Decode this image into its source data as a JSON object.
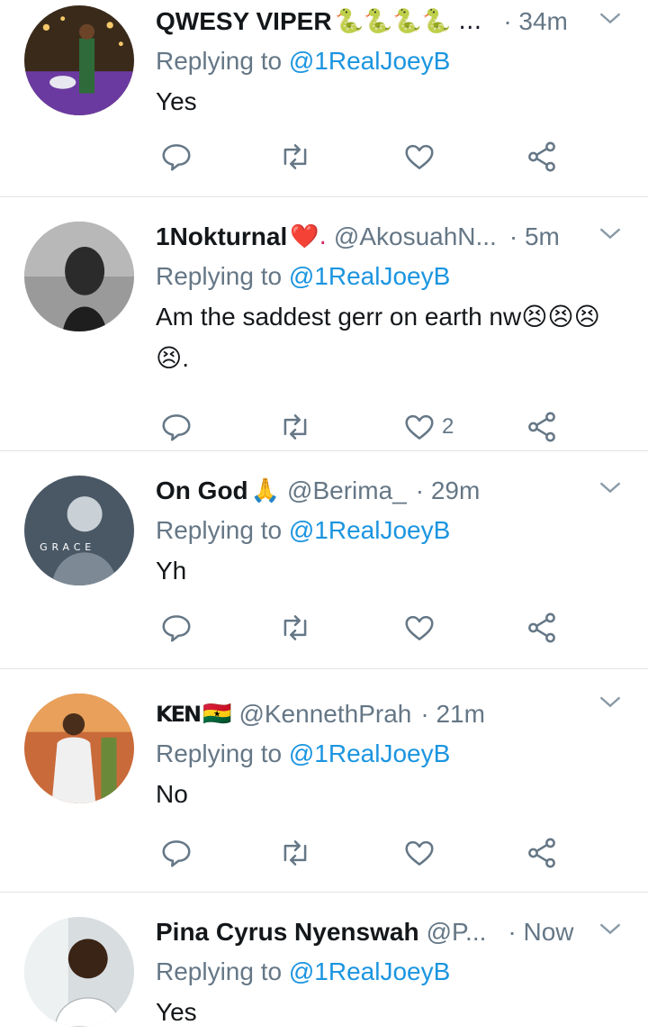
{
  "colors": {
    "link": "#1b95e0",
    "meta": "#657786",
    "text": "#14171a",
    "divider": "#dfe3e7"
  },
  "tweets": [
    {
      "name": "QWESY VIPER",
      "emoji": "🐍🐍🐍🐍 …",
      "handle": "",
      "time": "· 34m",
      "replying_prefix": "Replying to ",
      "replying_to": "@1RealJoeyB",
      "text": "Yes",
      "like_count": ""
    },
    {
      "name": "1Nokturnal",
      "emoji": "❤️.",
      "handle": "@AkosuahN...",
      "time": "· 5m",
      "replying_prefix": "Replying to ",
      "replying_to": "@1RealJoeyB",
      "text": "Am the saddest gerr on earth nw😣😣😣😣.",
      "like_count": "2"
    },
    {
      "name": "On God",
      "emoji": "🙏",
      "handle": "@Berima_",
      "time": "· 29m",
      "replying_prefix": "Replying to ",
      "replying_to": "@1RealJoeyB",
      "text": "Yh",
      "like_count": ""
    },
    {
      "name": "KEN",
      "emoji": "🇬🇭",
      "handle": "@KennethPrah",
      "time": "· 21m",
      "replying_prefix": "Replying to ",
      "replying_to": "@1RealJoeyB",
      "text": "No",
      "like_count": ""
    },
    {
      "name": "Pina Cyrus Nyenswah",
      "emoji": "",
      "handle": "@P...",
      "time": "· Now",
      "replying_prefix": "Replying to ",
      "replying_to": "@1RealJoeyB",
      "text": "Yes",
      "like_count": ""
    }
  ]
}
